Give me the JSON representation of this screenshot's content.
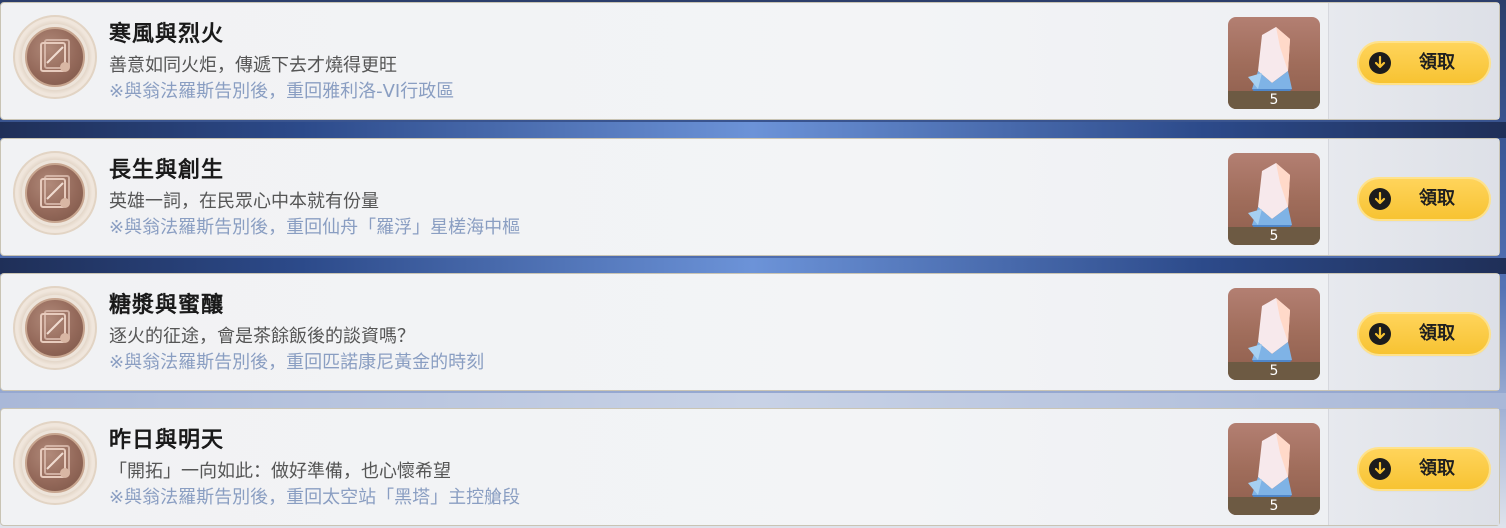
{
  "quests": [
    {
      "title": "寒風與烈火",
      "description": "善意如同火炬，傳遞下去才燒得更旺",
      "hint": "※與翁法羅斯告別後，重回雅利洛-VI行政區",
      "reward": {
        "icon": "crystal-icon",
        "count": "5"
      },
      "button": {
        "label": "領取",
        "icon": "arrow-down-circle-icon"
      }
    },
    {
      "title": "長生與創生",
      "description": "英雄一詞，在民眾心中本就有份量",
      "hint": "※與翁法羅斯告別後，重回仙舟「羅浮」星槎海中樞",
      "reward": {
        "icon": "crystal-icon",
        "count": "5"
      },
      "button": {
        "label": "領取",
        "icon": "arrow-down-circle-icon"
      }
    },
    {
      "title": "糖漿與蜜釀",
      "description": "逐火的征途，會是茶餘飯後的談資嗎？",
      "hint": "※與翁法羅斯告別後，重回匹諾康尼黃金的時刻",
      "reward": {
        "icon": "crystal-icon",
        "count": "5"
      },
      "button": {
        "label": "領取",
        "icon": "arrow-down-circle-icon"
      }
    },
    {
      "title": "昨日與明天",
      "description": "「開拓」一向如此：做好準備，也心懷希望",
      "hint": "※與翁法羅斯告別後，重回太空站「黑塔」主控艙段",
      "reward": {
        "icon": "crystal-icon",
        "count": "5"
      },
      "button": {
        "label": "領取",
        "icon": "arrow-down-circle-icon"
      }
    }
  ],
  "colors": {
    "button_yellow": "#f7c332",
    "hint_blue": "#8a9ec2",
    "title_black": "#1a1a1a"
  }
}
